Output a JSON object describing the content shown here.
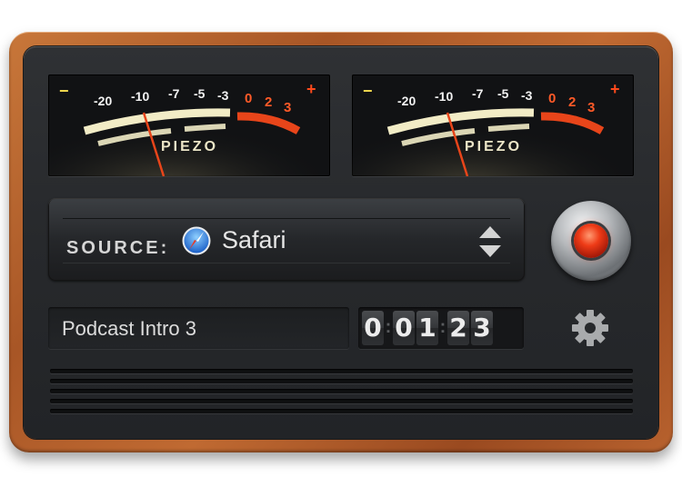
{
  "meters": {
    "scale_labels": [
      "-20",
      "-10",
      "-7",
      "-5",
      "-3",
      "0",
      "2",
      "3"
    ],
    "minus_sign": "−",
    "plus_sign": "+",
    "brand": "PIEZO",
    "needle_level_db": -10
  },
  "source": {
    "label": "SOURCE:",
    "value": "Safari",
    "icon": "safari-icon"
  },
  "recording": {
    "title": "Podcast Intro 3",
    "timer_digits": [
      "0",
      "0",
      "1",
      "2",
      "3"
    ],
    "timer_separator": ":"
  },
  "icons": {
    "record": "record-icon",
    "settings": "gear-icon",
    "source_stepper": "up-down-stepper-icon"
  },
  "colors": {
    "wood": "#b5602c",
    "panel": "#27292c",
    "meter_cream": "#f2ecc6",
    "meter_red": "#e8451a",
    "record_red": "#ee3b17"
  }
}
